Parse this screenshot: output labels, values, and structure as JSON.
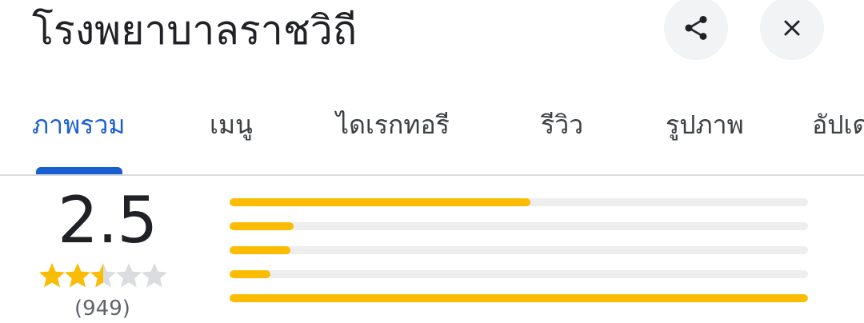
{
  "header": {
    "title": "โรงพยาบาลราชวิถี",
    "share_icon": "share-icon",
    "close_icon": "close-icon"
  },
  "tabs": [
    {
      "label": "ภาพรวม",
      "active": true
    },
    {
      "label": "เมนู",
      "active": false
    },
    {
      "label": "ไดเรกทอรี",
      "active": false
    },
    {
      "label": "รีวิว",
      "active": false
    },
    {
      "label": "รูปภาพ",
      "active": false
    },
    {
      "label": "อัปเด",
      "active": false
    }
  ],
  "rating": {
    "score": "2.5",
    "stars": 2.5,
    "max_stars": 5,
    "review_count": "(949)"
  },
  "distribution": [
    {
      "stars": 5,
      "fraction": 0.52
    },
    {
      "stars": 4,
      "fraction": 0.11
    },
    {
      "stars": 3,
      "fraction": 0.105
    },
    {
      "stars": 2,
      "fraction": 0.07
    },
    {
      "stars": 1,
      "fraction": 1.0
    }
  ],
  "colors": {
    "accent": "#1a5fd1",
    "star_filled": "#fbbc04",
    "star_empty": "#dadce0",
    "bar_fill": "#fbbc04",
    "bar_track": "#eeeeee"
  }
}
